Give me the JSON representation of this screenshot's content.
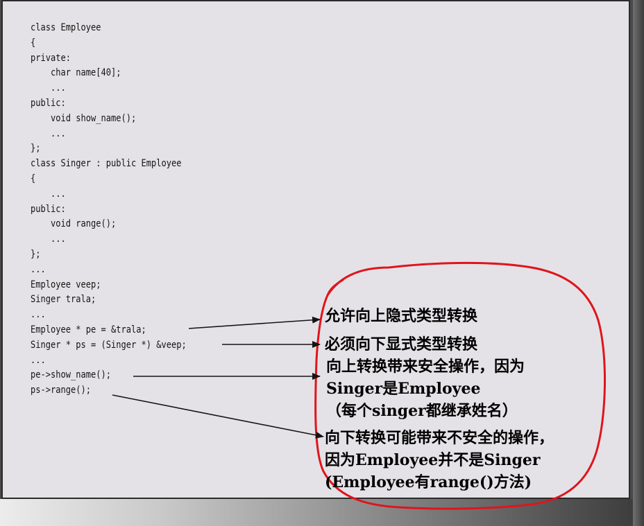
{
  "code_lines": [
    "class Employee",
    "{",
    "private:",
    "    char name[40];",
    "    ...",
    "public:",
    "    void show_name();",
    "    ...",
    "};",
    "class Singer : public Employee",
    "{",
    "    ...",
    "public:",
    "    void range();",
    "    ...",
    "};",
    "...",
    "Employee veep;",
    "Singer trala;",
    "...",
    "Employee * pe = &trala;",
    "Singer * ps = (Singer *) &veep;",
    "...",
    "pe->show_name();",
    "ps->range();"
  ],
  "annotations": {
    "upcast": "允许向上隐式类型转换",
    "downcast": "必须向下显式类型转换",
    "upcast_safe_1": "向上转换带来安全操作，因为",
    "upcast_safe_2": "Singer是Employee",
    "upcast_safe_3": "（每个singer都继承姓名）",
    "downcast_unsafe_1": "向下转换可能带来不安全的操作，",
    "downcast_unsafe_2": "因为Employee并不是Singer",
    "downcast_unsafe_3": "(Employee有range()方法)"
  },
  "colors": {
    "ink": "#141414",
    "annotation_circle": "#e0141c",
    "background_panel": "#e4e2e6"
  }
}
